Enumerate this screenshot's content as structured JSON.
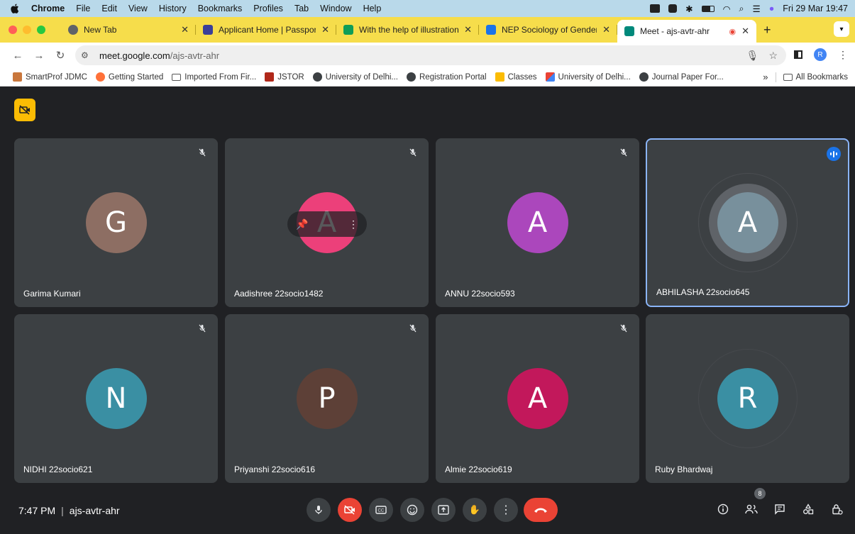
{
  "menubar": {
    "app": "Chrome",
    "items": [
      "File",
      "Edit",
      "View",
      "History",
      "Bookmarks",
      "Profiles",
      "Tab",
      "Window",
      "Help"
    ],
    "datetime": "Fri 29 Mar  19:47"
  },
  "tabs": [
    {
      "title": "New Tab",
      "favicon_color": "#5f6368"
    },
    {
      "title": "Applicant Home | Passport Se",
      "favicon_color": "#3a3f99"
    },
    {
      "title": "With the help of illustrations,",
      "favicon_color": "#0f9d58"
    },
    {
      "title": "NEP Sociology of Gender",
      "favicon_color": "#1a73e8"
    },
    {
      "title": "Meet - ajs-avtr-ahr",
      "favicon_color": "#00897b"
    }
  ],
  "address": {
    "host": "meet.google.com",
    "path": "/ajs-avtr-ahr"
  },
  "profile_initial": "R",
  "bookmarks": [
    {
      "label": "SmartProf JDMC",
      "icon": "smartprof-icon"
    },
    {
      "label": "Getting Started",
      "icon": "firefox-icon"
    },
    {
      "label": "Imported From Fir...",
      "icon": "folder-icon"
    },
    {
      "label": "JSTOR",
      "icon": "jstor-icon"
    },
    {
      "label": "University of Delhi...",
      "icon": "globe-icon"
    },
    {
      "label": "Registration Portal",
      "icon": "globe-icon"
    },
    {
      "label": "Classes",
      "icon": "classroom-icon"
    },
    {
      "label": "University of Delhi...",
      "icon": "du-icon"
    },
    {
      "label": "Journal Paper For...",
      "icon": "globe-icon"
    }
  ],
  "bookmarks_more": "»",
  "all_bookmarks": "All Bookmarks",
  "participants": [
    {
      "name": "Garima Kumari",
      "initial": "G",
      "color": "#8d6e63",
      "muted": true
    },
    {
      "name": "Aadishree 22socio1482",
      "initial": "A",
      "color": "#ec407a",
      "muted": true,
      "hover": true
    },
    {
      "name": "ANNU 22socio593",
      "initial": "A",
      "color": "#ab47bc",
      "muted": true
    },
    {
      "name": "ABHILASHA 22socio645",
      "initial": "A",
      "color": "#78909c",
      "muted": false,
      "speaking": true
    },
    {
      "name": "NIDHI 22socio621",
      "initial": "N",
      "color": "#3a8fa3",
      "muted": true
    },
    {
      "name": "Priyanshi 22socio616",
      "initial": "P",
      "color": "#5d4037",
      "muted": true
    },
    {
      "name": "Almie 22socio619",
      "initial": "A",
      "color": "#c2185b",
      "muted": true
    },
    {
      "name": "Ruby Bhardwaj",
      "initial": "R",
      "color": "#3a8fa3",
      "muted": false
    }
  ],
  "meeting": {
    "time": "7:47 PM",
    "separator": "|",
    "code": "ajs-avtr-ahr",
    "people_count": "8"
  },
  "colors": {
    "accent": "#8ab4f8",
    "danger": "#ea4335",
    "tile": "#3c4043",
    "bg": "#202124"
  }
}
